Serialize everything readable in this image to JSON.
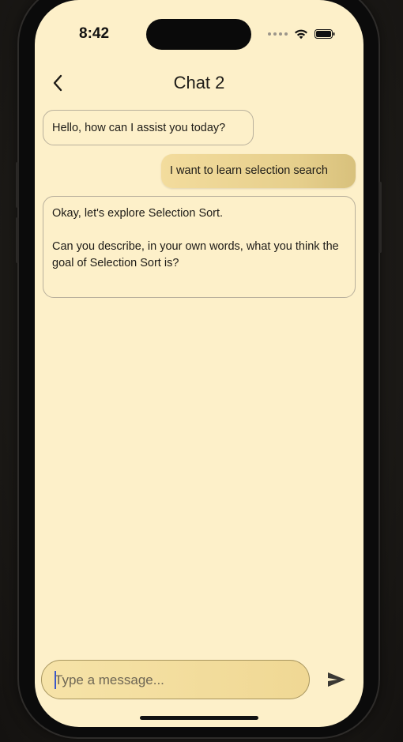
{
  "status_bar": {
    "time": "8:42",
    "icons": [
      "cellular-dots-icon",
      "wifi-icon",
      "battery-icon"
    ]
  },
  "header": {
    "title": "Chat 2",
    "back_icon": "chevron-left-icon"
  },
  "messages": [
    {
      "sender": "assistant",
      "text": "Hello, how can I assist you today?"
    },
    {
      "sender": "user",
      "text": "I want to learn selection search"
    },
    {
      "sender": "assistant",
      "paragraphs": [
        "Okay, let's explore Selection Sort.",
        "Can you describe, in your own words, what you think the goal of Selection Sort is?"
      ]
    }
  ],
  "composer": {
    "placeholder": "Type a message...",
    "value": "",
    "send_icon": "send-icon"
  },
  "colors": {
    "background": "#fdf0c9",
    "user_bubble": "#e6cf8c",
    "bubble_border": "#b9b09c",
    "text": "#1d1b17"
  }
}
